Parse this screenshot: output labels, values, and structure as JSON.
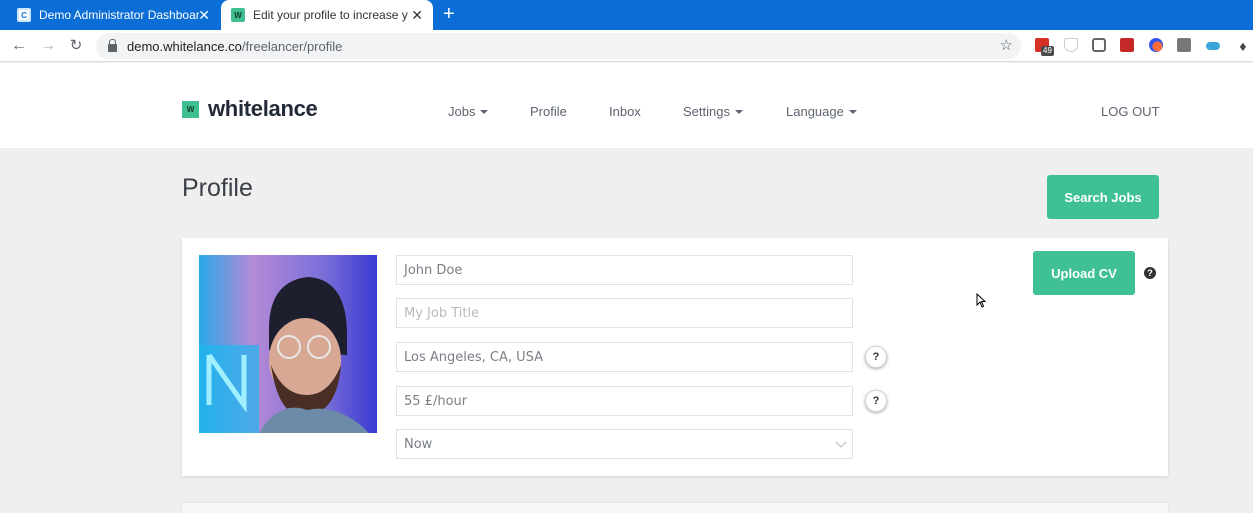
{
  "browser": {
    "tabs": [
      {
        "title": "Demo Administrator Dashboard",
        "favicon": "C",
        "active": false
      },
      {
        "title": "Edit your profile to increase your",
        "favicon": "W",
        "active": true
      }
    ],
    "new_tab_label": "+",
    "close_label": "✕",
    "url_host": "demo.whitelance.co",
    "url_path": "/freelancer/profile",
    "extension_badge": "49",
    "icons": [
      "back-icon",
      "forward-icon",
      "reload-icon",
      "lock-icon",
      "star-icon",
      "calendar-extension-icon",
      "shield-extension-icon",
      "camera-extension-icon",
      "arrow-extension-icon",
      "burst-extension-icon",
      "hubspot-extension-icon",
      "toggle-extension-icon",
      "puzzle-extensions-icon"
    ]
  },
  "site": {
    "logo_mark": "W",
    "logo_text": "whitelance",
    "menu": [
      {
        "label": "Jobs",
        "has_dropdown": true
      },
      {
        "label": "Profile",
        "has_dropdown": false
      },
      {
        "label": "Inbox",
        "has_dropdown": false
      },
      {
        "label": "Settings",
        "has_dropdown": true
      },
      {
        "label": "Language",
        "has_dropdown": true
      }
    ],
    "logout_label": "LOG OUT"
  },
  "page": {
    "title": "Profile",
    "search_jobs_label": "Search Jobs",
    "upload_cv_label": "Upload CV",
    "help_label": "?",
    "profile": {
      "avatar_alt": "Profile photo of man with beanie and glasses",
      "name_value": "John Doe",
      "job_title_placeholder": "My Job Title",
      "location_value": "Los Angeles, CA, USA",
      "rate_value": "55 £/hour",
      "availability_value": "Now"
    }
  },
  "colors": {
    "brand_green": "#3fc194",
    "browser_blue": "#0b6ed6",
    "text_dark": "#232a37"
  }
}
